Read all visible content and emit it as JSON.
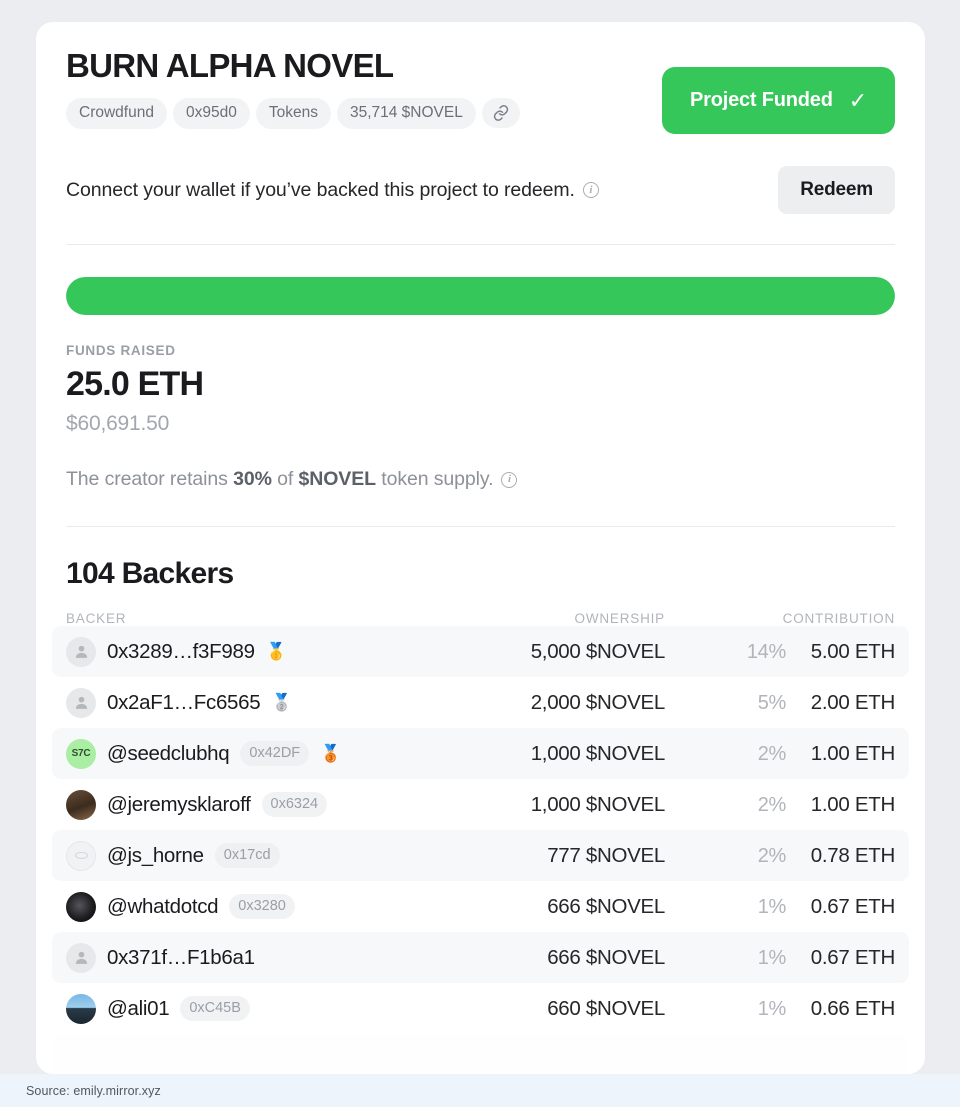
{
  "project": {
    "title": "BURN ALPHA NOVEL",
    "tags": [
      {
        "label": "Crowdfund"
      },
      {
        "label": "0x95d0"
      },
      {
        "label": "Tokens"
      },
      {
        "label": "35,714 $NOVEL"
      }
    ],
    "link_icon": "link-icon",
    "status_button": {
      "label": "Project Funded",
      "check": "✓",
      "color": "#35c75a"
    }
  },
  "connect": {
    "text": "Connect your wallet if you’ve backed this project to redeem.",
    "info_icon": "info-icon",
    "redeem_label": "Redeem"
  },
  "progress": {
    "percent": 100,
    "fill_color": "#35c75a"
  },
  "funds": {
    "label": "FUNDS RAISED",
    "amount": "25.0 ETH",
    "usd": "$60,691.50",
    "retains_prefix": "The creator retains ",
    "retains_pct": "30%",
    "retains_mid": " of ",
    "retains_token": "$NOVEL",
    "retains_suffix": " token supply.",
    "info_icon": "info-icon"
  },
  "backers": {
    "heading": "104 Backers",
    "count": 104,
    "columns": {
      "backer": "BACKER",
      "ownership": "OWNERSHIP",
      "contribution": "CONTRIBUTION"
    },
    "rows": [
      {
        "name": "0x3289…f3F989",
        "addr": "",
        "avatar": "person-icon",
        "medal": "🥇",
        "ownership": "5,000 $NOVEL",
        "percent": "14%",
        "contribution": "5.00 ETH"
      },
      {
        "name": "0x2aF1…Fc6565",
        "addr": "",
        "avatar": "person-icon",
        "medal": "🥈",
        "ownership": "2,000 $NOVEL",
        "percent": "5%",
        "contribution": "2.00 ETH"
      },
      {
        "name": "@seedclubhq",
        "addr": "0x42DF",
        "avatar": "s7c-avatar",
        "avatar_text": "S7C",
        "medal": "🥉",
        "ownership": "1,000 $NOVEL",
        "percent": "2%",
        "contribution": "1.00 ETH"
      },
      {
        "name": "@jeremysklaroff",
        "addr": "0x6324",
        "avatar": "photo-avatar",
        "medal": "",
        "ownership": "1,000 $NOVEL",
        "percent": "2%",
        "contribution": "1.00 ETH"
      },
      {
        "name": "@js_horne",
        "addr": "0x17cd",
        "avatar": "ring-avatar",
        "medal": "",
        "ownership": "777 $NOVEL",
        "percent": "2%",
        "contribution": "0.78 ETH"
      },
      {
        "name": "@whatdotcd",
        "addr": "0x3280",
        "avatar": "photo-avatar",
        "medal": "",
        "ownership": "666 $NOVEL",
        "percent": "1%",
        "contribution": "0.67 ETH"
      },
      {
        "name": "0x371f…F1b6a1",
        "addr": "",
        "avatar": "person-icon",
        "medal": "",
        "ownership": "666 $NOVEL",
        "percent": "1%",
        "contribution": "0.67 ETH"
      },
      {
        "name": "@ali01",
        "addr": "0xC45B",
        "avatar": "photo-avatar",
        "medal": "",
        "ownership": "660 $NOVEL",
        "percent": "1%",
        "contribution": "0.66 ETH"
      }
    ]
  },
  "footer": {
    "source": "Source: emily.mirror.xyz"
  }
}
